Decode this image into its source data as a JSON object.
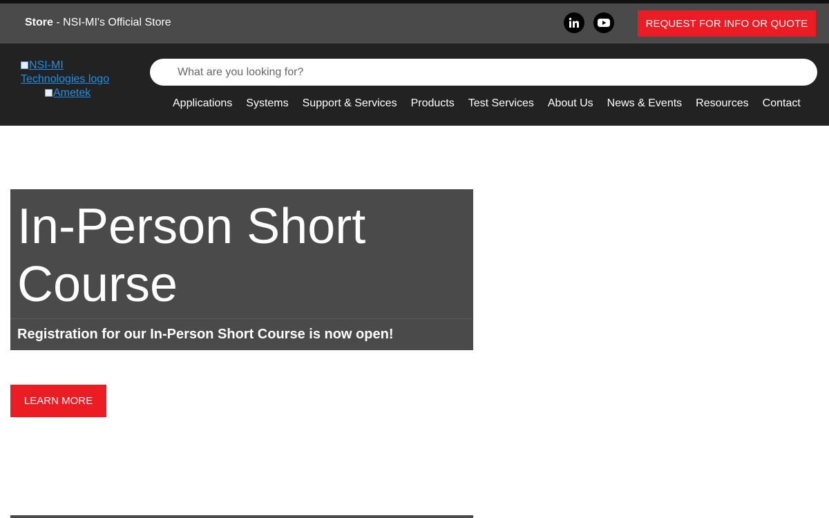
{
  "topbar": {
    "store_bold": "Store",
    "store_rest": " - NSI-MI's Official Store",
    "social": [
      "linkedin-icon",
      "youtube-icon"
    ],
    "quote_button": "REQUEST FOR INFO OR QUOTE"
  },
  "header": {
    "logo_alt": "NSI-MI Technologies logo",
    "ametek_alt": "Ametek",
    "search_placeholder": "What are you looking for?",
    "nav": [
      "Applications",
      "Systems",
      "Support & Services",
      "Products",
      "Test Services",
      "About Us",
      "News & Events",
      "Resources",
      "Contact"
    ]
  },
  "hero": {
    "title": "In-Person Short Course",
    "subtitle": "Registration for our In-Person Short Course is now open!",
    "button": "LEARN MORE"
  },
  "colors": {
    "accent": "#ec1c24",
    "topbar": "#4a4a4a",
    "header": "#222222",
    "link": "#1e8fe8"
  }
}
